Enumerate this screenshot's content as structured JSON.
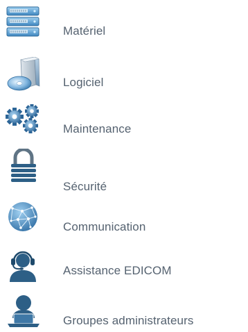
{
  "menu": {
    "items": [
      {
        "key": "materiel",
        "label": "Matériel",
        "icon": "server-rack-icon"
      },
      {
        "key": "logiciel",
        "label": "Logiciel",
        "icon": "software-box-cd-icon"
      },
      {
        "key": "maintenance",
        "label": "Maintenance",
        "icon": "gears-icon"
      },
      {
        "key": "securite",
        "label": "Sécurité",
        "icon": "padlock-icon"
      },
      {
        "key": "communication",
        "label": "Communication",
        "icon": "globe-network-icon"
      },
      {
        "key": "assistance",
        "label": "Assistance EDICOM",
        "icon": "headset-support-icon"
      },
      {
        "key": "groupes",
        "label": "Groupes administrateurs",
        "icon": "admin-user-laptop-icon"
      }
    ]
  },
  "colors": {
    "label_text": "#556270",
    "icon_dark_blue": "#2d5f86",
    "icon_mid_blue": "#4a86b8",
    "icon_light_blue": "#7fb6de"
  }
}
